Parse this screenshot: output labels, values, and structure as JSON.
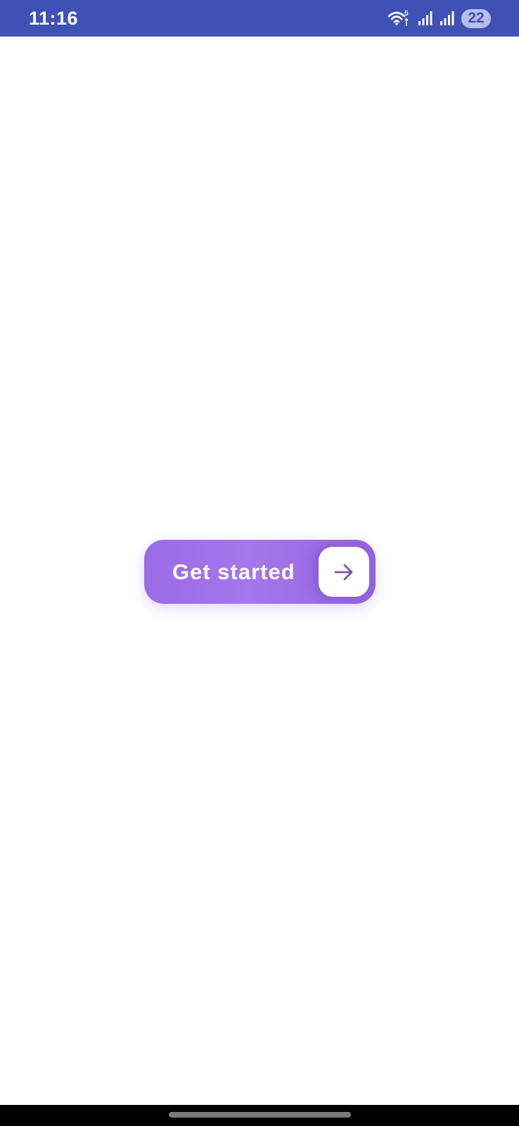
{
  "status_bar": {
    "time": "11:16",
    "wifi_badge": "5",
    "battery": "22",
    "background_color": "#3f51b5"
  },
  "main": {
    "cta_label": "Get started",
    "cta_icon": "arrow-right-icon",
    "cta_color": "#a070ea"
  }
}
